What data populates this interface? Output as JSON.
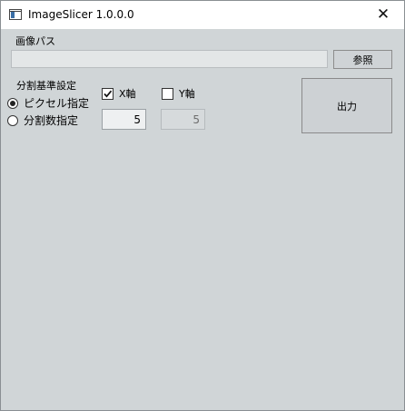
{
  "window": {
    "title": "ImageSlicer 1.0.0.0",
    "close_glyph": "✕"
  },
  "image_path": {
    "label": "画像パス",
    "value": "",
    "placeholder": "",
    "browse_label": "参照"
  },
  "split_basis": {
    "label": "分割基準設定",
    "options": [
      {
        "label": "ピクセル指定",
        "selected": true
      },
      {
        "label": "分割数指定",
        "selected": false
      }
    ]
  },
  "x_axis": {
    "label": "X軸",
    "checked": true,
    "value": "5",
    "enabled": true
  },
  "y_axis": {
    "label": "Y軸",
    "checked": false,
    "value": "5",
    "enabled": false
  },
  "output_button": {
    "label": "出力"
  },
  "icons": {
    "app": "app-window-icon",
    "close": "close-icon",
    "check": "checkmark-icon"
  }
}
